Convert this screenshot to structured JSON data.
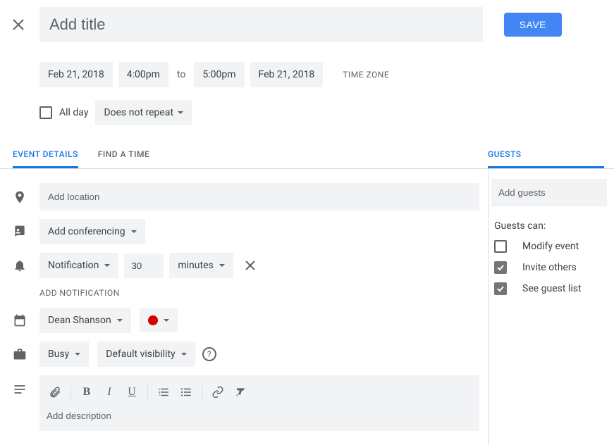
{
  "title_placeholder": "Add title",
  "save_label": "SAVE",
  "start_date": "Feb 21, 2018",
  "start_time": "4:00pm",
  "end_time": "5:00pm",
  "end_date": "Feb 21, 2018",
  "to_label": "to",
  "timezone_label": "TIME ZONE",
  "allday_label": "All day",
  "recurrence_label": "Does not repeat",
  "tabs": {
    "event_details": "EVENT DETAILS",
    "find_time": "FIND A TIME",
    "guests": "GUESTS"
  },
  "location_placeholder": "Add location",
  "conferencing_label": "Add conferencing",
  "notification": {
    "type": "Notification",
    "value": "30",
    "unit": "minutes"
  },
  "add_notification": "ADD NOTIFICATION",
  "calendar_name": "Dean Shanson",
  "busy_label": "Busy",
  "visibility_label": "Default visibility",
  "description_placeholder": "Add description",
  "guests_placeholder": "Add guests",
  "guests_can_label": "Guests can:",
  "permissions": {
    "modify": "Modify event",
    "invite": "Invite others",
    "see_list": "See guest list"
  }
}
